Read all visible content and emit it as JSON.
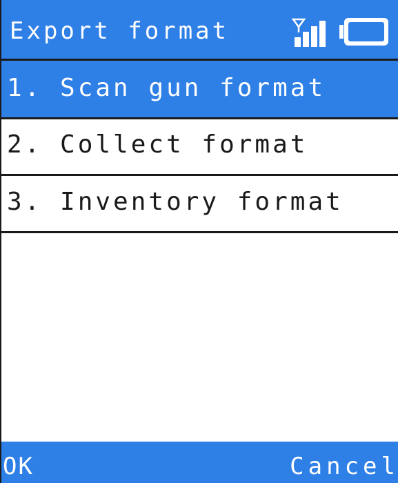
{
  "header": {
    "title": "Export format",
    "signal_icon": "signal-strength-icon",
    "battery_icon": "battery-icon"
  },
  "menu": {
    "items": [
      {
        "label": "1. Scan gun format",
        "selected": true
      },
      {
        "label": "2. Collect format",
        "selected": false
      },
      {
        "label": "3. Inventory format",
        "selected": false
      }
    ]
  },
  "footer": {
    "ok_label": "OK",
    "cancel_label": "Cancel"
  },
  "colors": {
    "accent": "#2e7fe6",
    "text": "#1a1a1a",
    "background": "#ffffff"
  }
}
